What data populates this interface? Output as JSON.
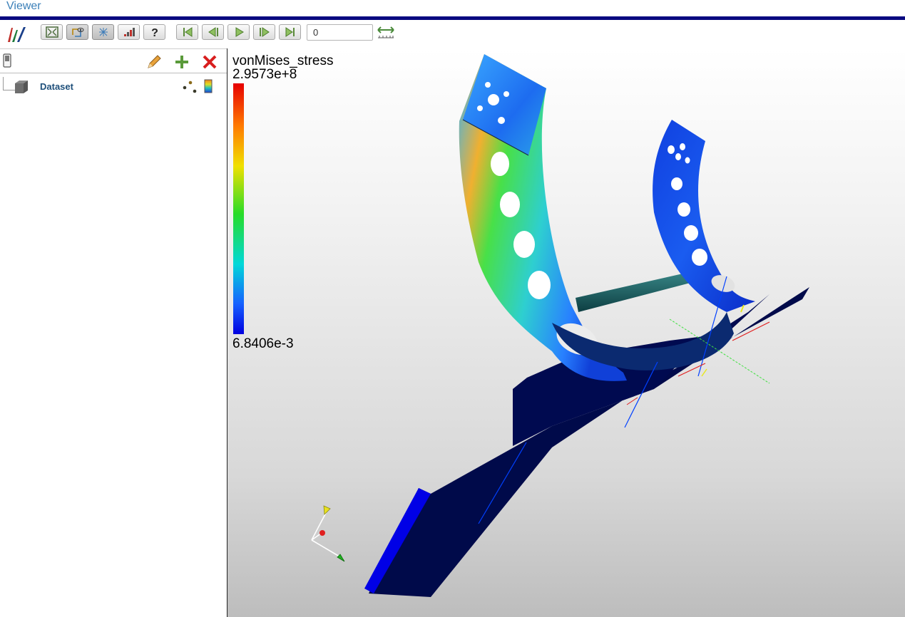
{
  "app": {
    "title": "Viewer"
  },
  "toolbar": {
    "buttons": [
      {
        "id": "reset-camera",
        "icon": "reset-camera-icon"
      },
      {
        "id": "interaction-mode",
        "icon": "rotate-eye-icon",
        "active": true
      },
      {
        "id": "center-of-rotation",
        "icon": "center-rotation-icon",
        "active": true
      },
      {
        "id": "statistics",
        "icon": "stats-icon"
      },
      {
        "id": "help",
        "icon": "help-icon"
      },
      {
        "id": "first-frame",
        "icon": "first-frame-icon"
      },
      {
        "id": "previous-frame",
        "icon": "previous-frame-icon"
      },
      {
        "id": "play",
        "icon": "play-icon"
      },
      {
        "id": "next-frame",
        "icon": "next-frame-icon"
      },
      {
        "id": "last-frame",
        "icon": "last-frame-icon"
      }
    ],
    "frame_value": "0"
  },
  "pipeline": {
    "items": [
      {
        "label": "Dataset",
        "representation": "points-icon",
        "color_by": "colormap-icon"
      }
    ]
  },
  "legend": {
    "array_name": "vonMises_stress",
    "max_label": "2.9573e+8",
    "min_label": "6.8406e-3",
    "colors": [
      "#e60000",
      "#ff7a00",
      "#f0e000",
      "#28dc28",
      "#00d8d8",
      "#1560ff",
      "#0000e0"
    ]
  },
  "colors": {
    "title": "#3a7fb8",
    "title_rule": "#0a0a80",
    "base_plate": "#000a4a",
    "accent_blue": "#0000e6"
  }
}
